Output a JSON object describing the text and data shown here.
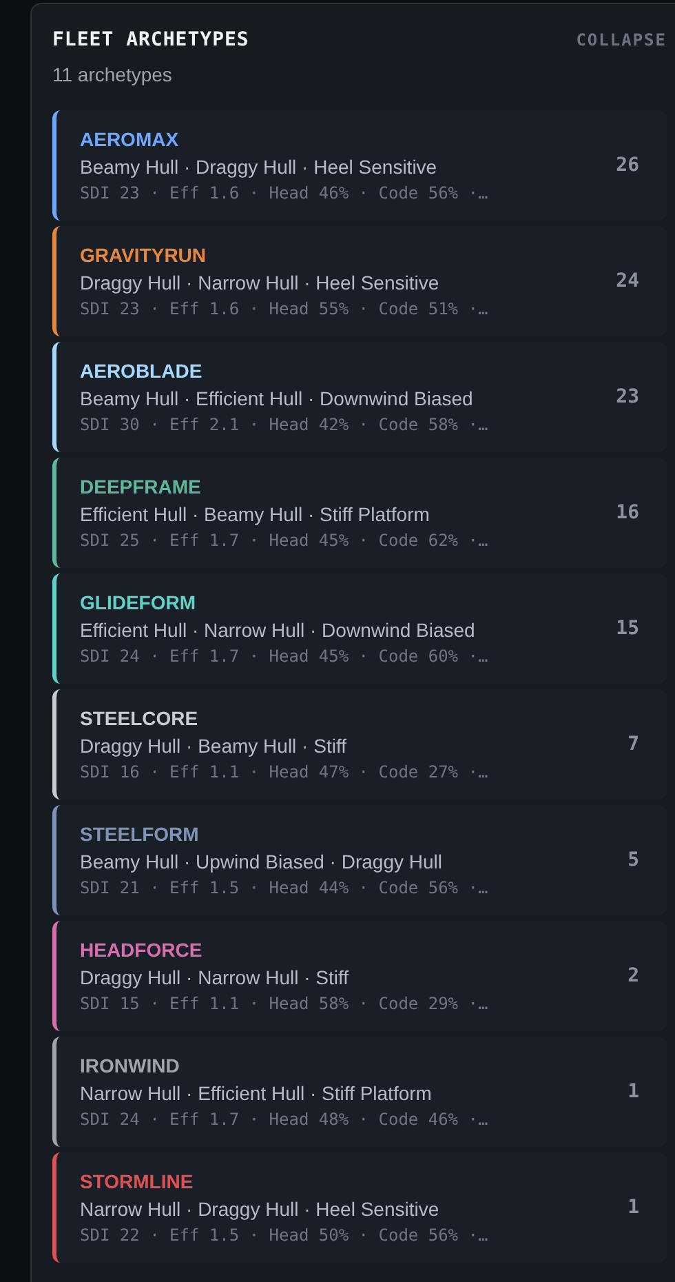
{
  "panel": {
    "title": "FLEET ARCHETYPES",
    "action": "COLLAPSE",
    "subtitle": "11 archetypes"
  },
  "archetypes": [
    {
      "name": "AEROMAX",
      "color": "#6ea8fe",
      "tags": "Beamy Hull · Draggy Hull · Heel Sensitive",
      "stats": "SDI 23 · Eff 1.6 · Head 46% · Code 56% ·…",
      "count": "26"
    },
    {
      "name": "GRAVITYRUN",
      "color": "#e8863a",
      "tags": "Draggy Hull · Narrow Hull · Heel Sensitive",
      "stats": "SDI 23 · Eff 1.6 · Head 55% · Code 51% ·…",
      "count": "24"
    },
    {
      "name": "AEROBLADE",
      "color": "#a5d8ff",
      "tags": "Beamy Hull · Efficient Hull · Downwind Biased",
      "stats": "SDI 30 · Eff 2.1 · Head 42% · Code 58% ·…",
      "count": "23"
    },
    {
      "name": "DEEPFRAME",
      "color": "#5fb89a",
      "tags": "Efficient Hull · Beamy Hull · Stiff Platform",
      "stats": "SDI 25 · Eff 1.7 · Head 45% · Code 62% ·…",
      "count": "16"
    },
    {
      "name": "GLIDEFORM",
      "color": "#5fd3c8",
      "tags": "Efficient Hull · Narrow Hull · Downwind Biased",
      "stats": "SDI 24 · Eff 1.7 · Head 45% · Code 60% ·…",
      "count": "15"
    },
    {
      "name": "STEELCORE",
      "color": "#c9ccd1",
      "tags": "Draggy Hull · Beamy Hull · Stiff",
      "stats": "SDI 16 · Eff 1.1 · Head 47% · Code 27% ·…",
      "count": "7"
    },
    {
      "name": "STEELFORM",
      "color": "#7f93b8",
      "tags": "Beamy Hull · Upwind Biased · Draggy Hull",
      "stats": "SDI 21 · Eff 1.5 · Head 44% · Code 56% ·…",
      "count": "5"
    },
    {
      "name": "HEADFORCE",
      "color": "#d96fb0",
      "tags": "Draggy Hull · Narrow Hull · Stiff",
      "stats": "SDI 15 · Eff 1.1 · Head 58% · Code 29% ·…",
      "count": "2"
    },
    {
      "name": "IRONWIND",
      "color": "#a0a4ab",
      "tags": "Narrow Hull · Efficient Hull · Stiff Platform",
      "stats": "SDI 24 · Eff 1.7 · Head 48% · Code 46% ·…",
      "count": "1"
    },
    {
      "name": "STORMLINE",
      "color": "#e05252",
      "tags": "Narrow Hull · Draggy Hull · Heel Sensitive",
      "stats": "SDI 22 · Eff 1.5 · Head 50% · Code 56% ·…",
      "count": "1"
    }
  ]
}
